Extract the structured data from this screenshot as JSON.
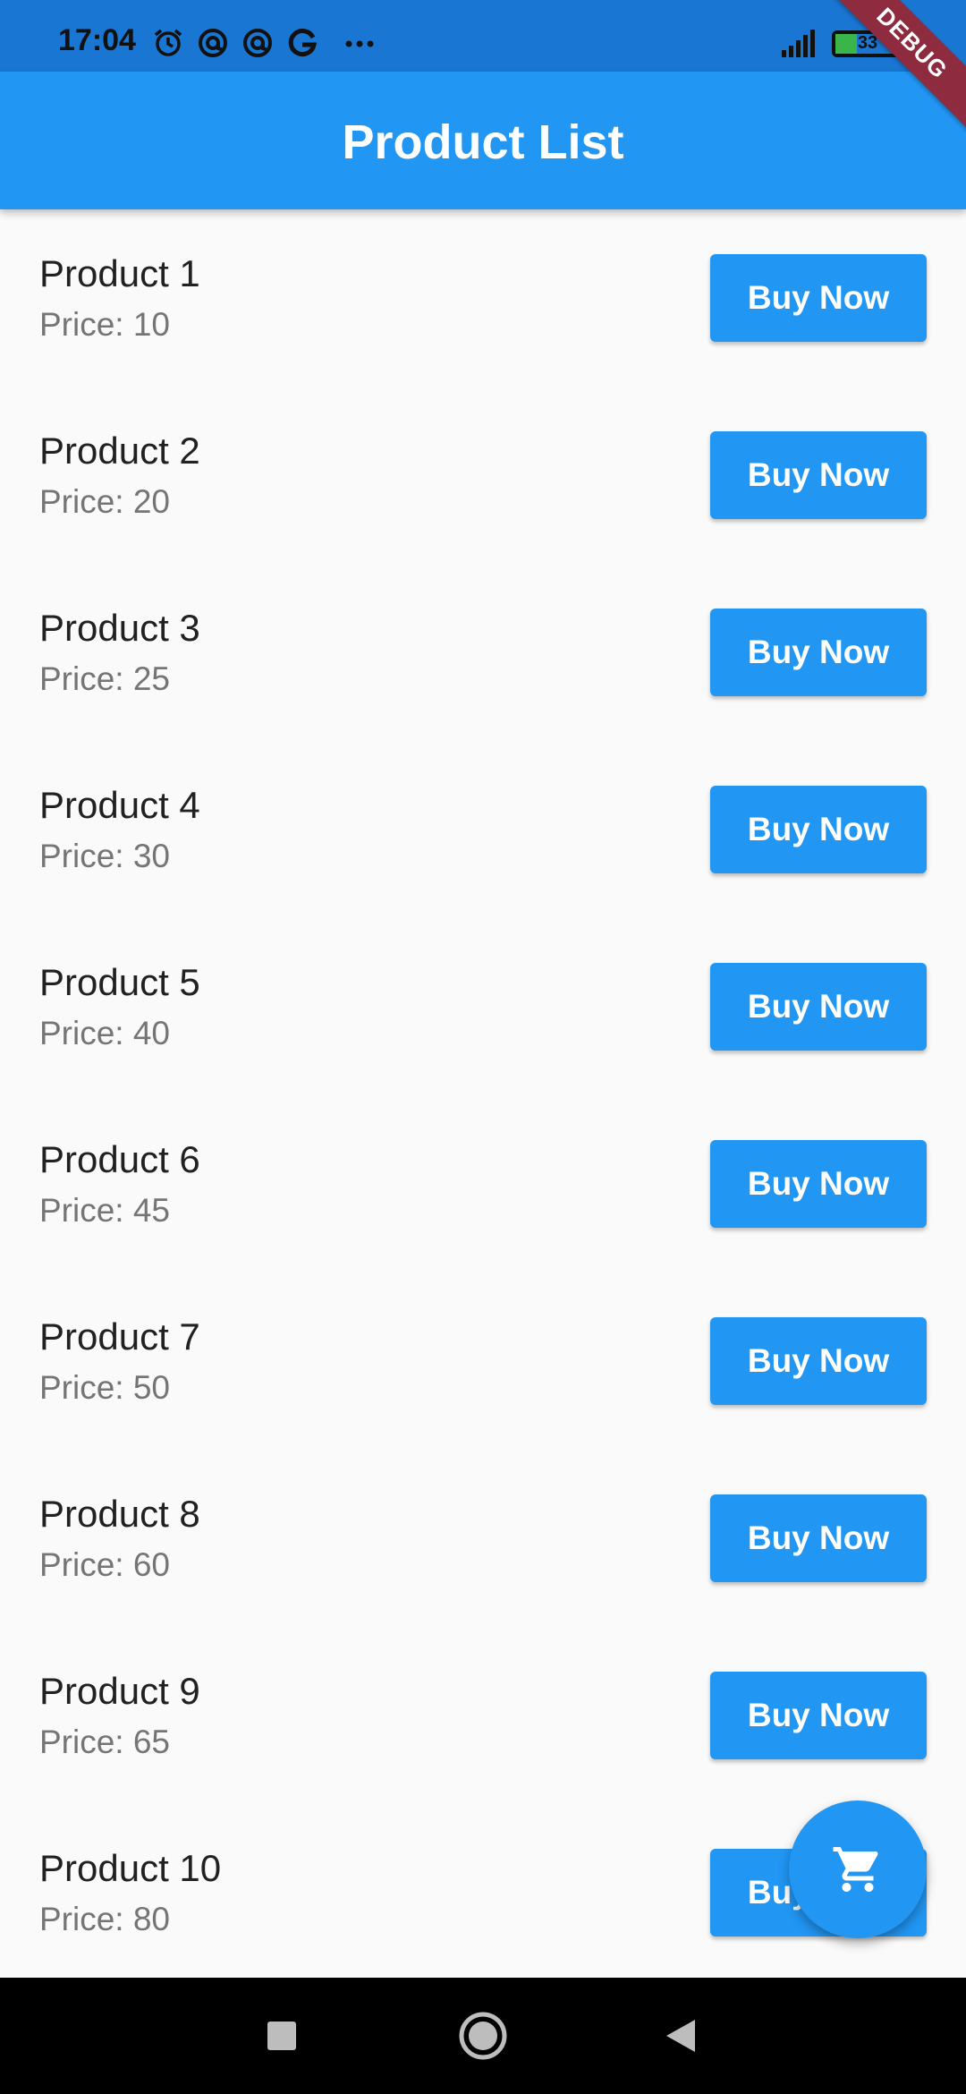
{
  "status_bar": {
    "time": "17:04",
    "battery_level": 33,
    "battery_label": "33",
    "debug_label": "DEBUG",
    "icons": [
      "alarm-icon",
      "at-sign-icon",
      "at-sign-icon",
      "google-icon",
      "more-icon",
      "signal-icon",
      "battery-icon"
    ]
  },
  "app_bar": {
    "title": "Product List"
  },
  "products": [
    {
      "name": "Product 1",
      "price": "Price: 10",
      "button": "Buy Now"
    },
    {
      "name": "Product 2",
      "price": "Price: 20",
      "button": "Buy Now"
    },
    {
      "name": "Product 3",
      "price": "Price: 25",
      "button": "Buy Now"
    },
    {
      "name": "Product 4",
      "price": "Price: 30",
      "button": "Buy Now"
    },
    {
      "name": "Product 5",
      "price": "Price: 40",
      "button": "Buy Now"
    },
    {
      "name": "Product 6",
      "price": "Price: 45",
      "button": "Buy Now"
    },
    {
      "name": "Product 7",
      "price": "Price: 50",
      "button": "Buy Now"
    },
    {
      "name": "Product 8",
      "price": "Price: 60",
      "button": "Buy Now"
    },
    {
      "name": "Product 9",
      "price": "Price: 65",
      "button": "Buy Now"
    },
    {
      "name": "Product 10",
      "price": "Price: 80",
      "button": "Buy Now"
    }
  ],
  "fab": {
    "icon": "cart-icon"
  },
  "nav_bar": {
    "icons": [
      "recents-icon",
      "home-icon",
      "back-icon"
    ]
  },
  "colors": {
    "primary": "#2196f3",
    "status_bar": "#1976d2",
    "debug_banner": "#8e2b3e",
    "background": "#fafafa"
  }
}
